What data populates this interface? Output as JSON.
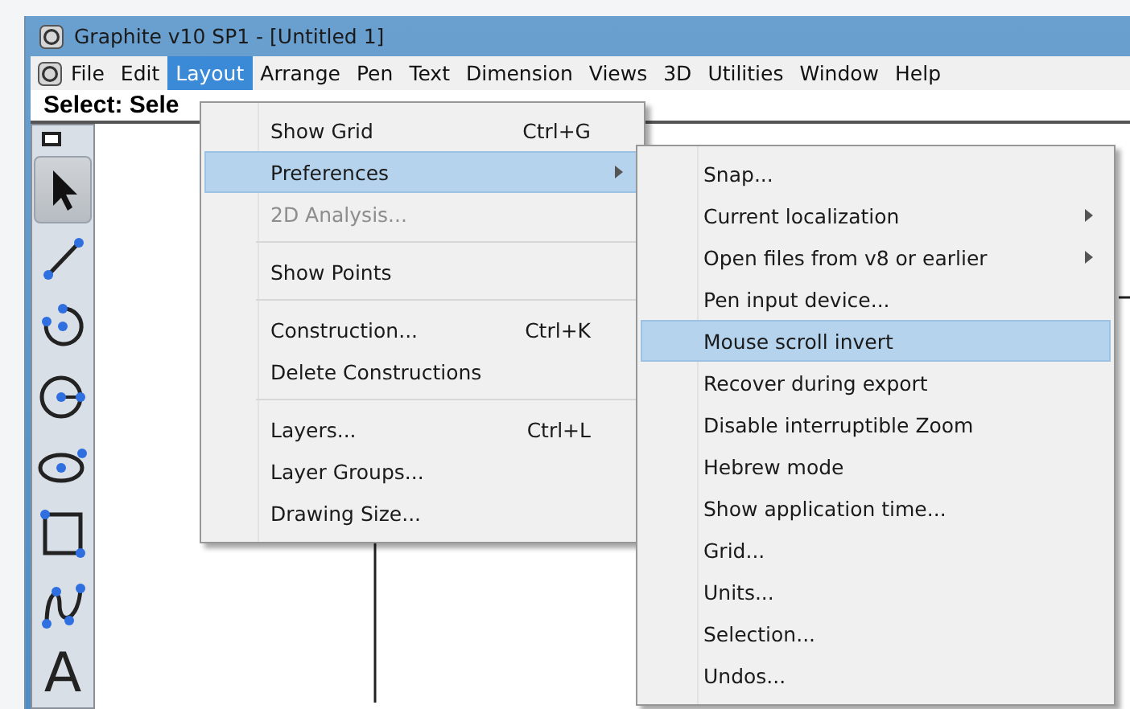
{
  "window": {
    "title": "Graphite v10 SP1 - [Untitled 1]"
  },
  "menu_bar": [
    {
      "label": "File",
      "selected": false
    },
    {
      "label": "Edit",
      "selected": false
    },
    {
      "label": "Layout",
      "selected": true
    },
    {
      "label": "Arrange",
      "selected": false
    },
    {
      "label": "Pen",
      "selected": false
    },
    {
      "label": "Text",
      "selected": false
    },
    {
      "label": "Dimension",
      "selected": false
    },
    {
      "label": "Views",
      "selected": false
    },
    {
      "label": "3D",
      "selected": false
    },
    {
      "label": "Utilities",
      "selected": false
    },
    {
      "label": "Window",
      "selected": false
    },
    {
      "label": "Help",
      "selected": false
    }
  ],
  "prompt": "Select: Sele",
  "tools": [
    {
      "kind": "select",
      "selected": true
    },
    {
      "kind": "line",
      "selected": false
    },
    {
      "kind": "arc",
      "selected": false
    },
    {
      "kind": "circle",
      "selected": false
    },
    {
      "kind": "ellipse",
      "selected": false
    },
    {
      "kind": "rectangle",
      "selected": false
    },
    {
      "kind": "spline",
      "selected": false
    },
    {
      "kind": "text",
      "label": "A",
      "selected": false
    }
  ],
  "layout_menu": [
    {
      "kind": "item",
      "label": "Show Grid",
      "shortcut": "Ctrl+G",
      "selected": false,
      "disabled": false,
      "submenu": false
    },
    {
      "kind": "item",
      "label": "Preferences",
      "selected": true,
      "disabled": false,
      "submenu": true
    },
    {
      "kind": "item",
      "label": "2D Analysis...",
      "selected": false,
      "disabled": true,
      "submenu": false
    },
    {
      "kind": "separator"
    },
    {
      "kind": "item",
      "label": "Show Points",
      "selected": false,
      "disabled": false,
      "submenu": false
    },
    {
      "kind": "separator"
    },
    {
      "kind": "item",
      "label": "Construction...",
      "shortcut": "Ctrl+K",
      "selected": false,
      "disabled": false,
      "submenu": false
    },
    {
      "kind": "item",
      "label": "Delete Constructions",
      "selected": false,
      "disabled": false,
      "submenu": false
    },
    {
      "kind": "separator"
    },
    {
      "kind": "item",
      "label": "Layers...",
      "shortcut": "Ctrl+L",
      "selected": false,
      "disabled": false,
      "submenu": false
    },
    {
      "kind": "item",
      "label": "Layer Groups...",
      "selected": false,
      "disabled": false,
      "submenu": false
    },
    {
      "kind": "item",
      "label": "Drawing Size...",
      "selected": false,
      "disabled": false,
      "submenu": false
    }
  ],
  "preferences_menu": [
    {
      "kind": "item",
      "label": "Snap...",
      "selected": false,
      "disabled": false,
      "submenu": false
    },
    {
      "kind": "item",
      "label": "Current localization",
      "selected": false,
      "disabled": false,
      "submenu": true
    },
    {
      "kind": "item",
      "label": "Open files from v8 or earlier",
      "selected": false,
      "disabled": false,
      "submenu": true
    },
    {
      "kind": "item",
      "label": "Pen input device...",
      "selected": false,
      "disabled": false,
      "submenu": false
    },
    {
      "kind": "item",
      "label": "Mouse scroll invert",
      "selected": true,
      "disabled": false,
      "submenu": false
    },
    {
      "kind": "item",
      "label": "Recover during export",
      "selected": false,
      "disabled": false,
      "submenu": false
    },
    {
      "kind": "item",
      "label": "Disable interruptible Zoom",
      "selected": false,
      "disabled": false,
      "submenu": false
    },
    {
      "kind": "item",
      "label": "Hebrew mode",
      "selected": false,
      "disabled": false,
      "submenu": false
    },
    {
      "kind": "item",
      "label": "Show application time...",
      "selected": false,
      "disabled": false,
      "submenu": false
    },
    {
      "kind": "item",
      "label": "Grid...",
      "selected": false,
      "disabled": false,
      "submenu": false
    },
    {
      "kind": "item",
      "label": "Units...",
      "selected": false,
      "disabled": false,
      "submenu": false
    },
    {
      "kind": "item",
      "label": "Selection...",
      "selected": false,
      "disabled": false,
      "submenu": false
    },
    {
      "kind": "item",
      "label": "Undos...",
      "selected": false,
      "disabled": false,
      "submenu": false
    }
  ]
}
